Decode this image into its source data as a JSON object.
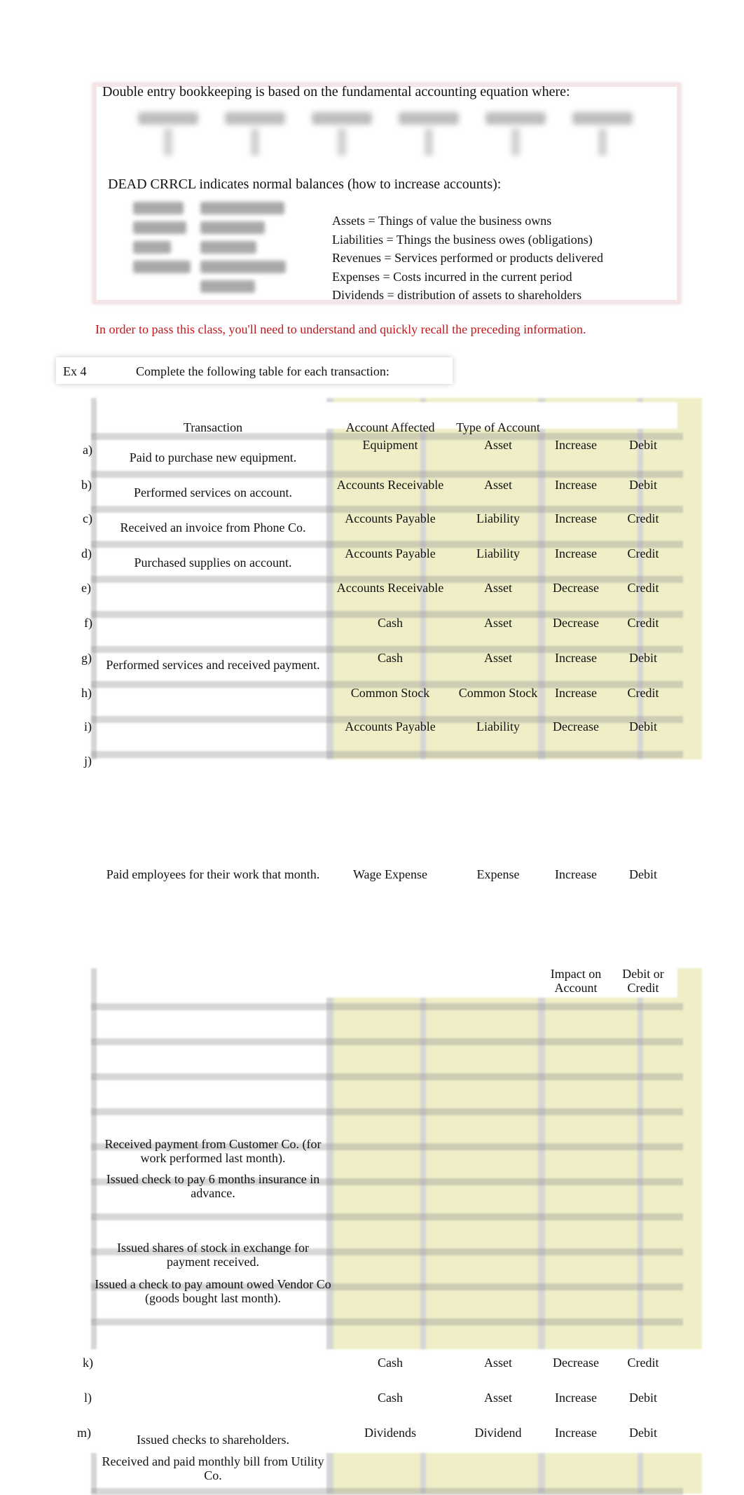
{
  "intro": {
    "equation_text": "Double entry bookkeeping is based on the fundamental accounting equation where:",
    "equation_terms_obscured": 6,
    "mnemonic_title": "DEAD CRRCL indicates normal balances (how to increase accounts):",
    "definitions": [
      "Assets = Things of value the business owns",
      "Liabilities = Things the business owes (obligations)",
      "Revenues = Services performed or products delivered",
      "Expenses = Costs incurred in the current period",
      "Dividends = distribution of assets to shareholders"
    ]
  },
  "warning": "In order to pass this class, you'll need to understand and quickly recall the preceding information.",
  "exercise": {
    "label": "Ex 4",
    "instruction": "Complete the following table for each transaction:"
  },
  "table": {
    "headers": {
      "transaction": "Transaction",
      "account": "Account Affected",
      "type": "Type of Account",
      "impact": "Impact on Account",
      "debit_credit": "Debit  or Credit"
    },
    "rows": [
      {
        "letter": "a)",
        "transaction": "Paid to purchase new equipment.",
        "account": "Equipment",
        "type": "Asset",
        "impact": "Increase",
        "dc": "Debit"
      },
      {
        "letter": "b)",
        "transaction": "Performed services on account.",
        "account": "Accounts Receivable",
        "type": "Asset",
        "impact": "Increase",
        "dc": "Debit"
      },
      {
        "letter": "c)",
        "transaction": "Received an invoice from Phone Co.",
        "account": "Accounts Payable",
        "type": "Liability",
        "impact": "Increase",
        "dc": "Credit"
      },
      {
        "letter": "d)",
        "transaction": "Purchased supplies on account.",
        "account": "Accounts Payable",
        "type": "Liability",
        "impact": "Increase",
        "dc": "Credit"
      },
      {
        "letter": "e)",
        "transaction": "",
        "account": "Accounts Receivable",
        "type": "Asset",
        "impact": "Decrease",
        "dc": "Credit"
      },
      {
        "letter": "f)",
        "transaction": "",
        "account": "Cash",
        "type": "Asset",
        "impact": "Decrease",
        "dc": "Credit"
      },
      {
        "letter": "g)",
        "transaction": "Performed services and received payment.",
        "account": "Cash",
        "type": "Asset",
        "impact": "Increase",
        "dc": "Debit"
      },
      {
        "letter": "h)",
        "transaction": "",
        "account": "Common Stock",
        "type": "Common Stock",
        "impact": "Increase",
        "dc": "Credit"
      },
      {
        "letter": "i)",
        "transaction": "",
        "account": "Accounts Payable",
        "type": "Liability",
        "impact": "Decrease",
        "dc": "Debit"
      },
      {
        "letter": "j)",
        "transaction": "Paid employees for their work that month.",
        "account": "Wage Expense",
        "type": "Expense",
        "impact": "Increase",
        "dc": "Debit"
      },
      {
        "letter": "k)",
        "transaction": "",
        "account": "Cash",
        "type": "Asset",
        "impact": "Decrease",
        "dc": "Credit"
      },
      {
        "letter": "l)",
        "transaction": "",
        "account": "Cash",
        "type": "Asset",
        "impact": "Increase",
        "dc": "Debit"
      },
      {
        "letter": "m)",
        "transaction": "Issued checks to shareholders.",
        "account": "Dividends",
        "type": "Dividend",
        "impact": "Increase",
        "dc": "Debit"
      }
    ],
    "extra_transactions": [
      "Received payment from Customer Co. (for work performed last month).",
      "Issued check to pay 6 months insurance in advance.",
      "Issued shares of stock in exchange for payment received.",
      "Issued a check to pay amount owed Vendor Co (goods bought last month).",
      "Received and paid monthly bill from Utility Co."
    ]
  },
  "colors": {
    "warning": "#c0181c",
    "answer_cell": "#efeec7",
    "grid_line": "#d6d6d6"
  }
}
